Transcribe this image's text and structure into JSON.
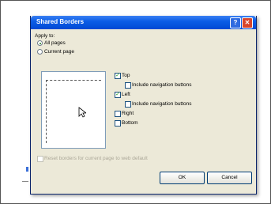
{
  "dialog": {
    "title": "Shared Borders",
    "help_glyph": "?",
    "close_glyph": "✕"
  },
  "apply_to": {
    "label": "Apply to:",
    "all_pages": "All pages",
    "current_page": "Current page",
    "selected": "all_pages"
  },
  "borders": {
    "top": {
      "label": "Top",
      "checked": true
    },
    "top_nav": {
      "label": "Include navigation buttons",
      "checked": false
    },
    "left": {
      "label": "Left",
      "checked": true
    },
    "left_nav": {
      "label": "Include navigation buttons",
      "checked": false
    },
    "right": {
      "label": "Right",
      "checked": false
    },
    "bottom": {
      "label": "Bottom",
      "checked": false
    }
  },
  "reset": {
    "label": "Reset borders for current page to web default",
    "checked": false,
    "enabled": false
  },
  "buttons": {
    "ok": "OK",
    "cancel": "Cancel"
  },
  "icons": {
    "check": "✓",
    "help": "help-icon",
    "close": "close-icon",
    "cursor": "mouse-pointer-icon"
  },
  "colors": {
    "titlebar": "#0b5de6",
    "dialog_bg": "#ece9d8",
    "close_button": "#d8452b",
    "check_mark": "#21a121"
  }
}
